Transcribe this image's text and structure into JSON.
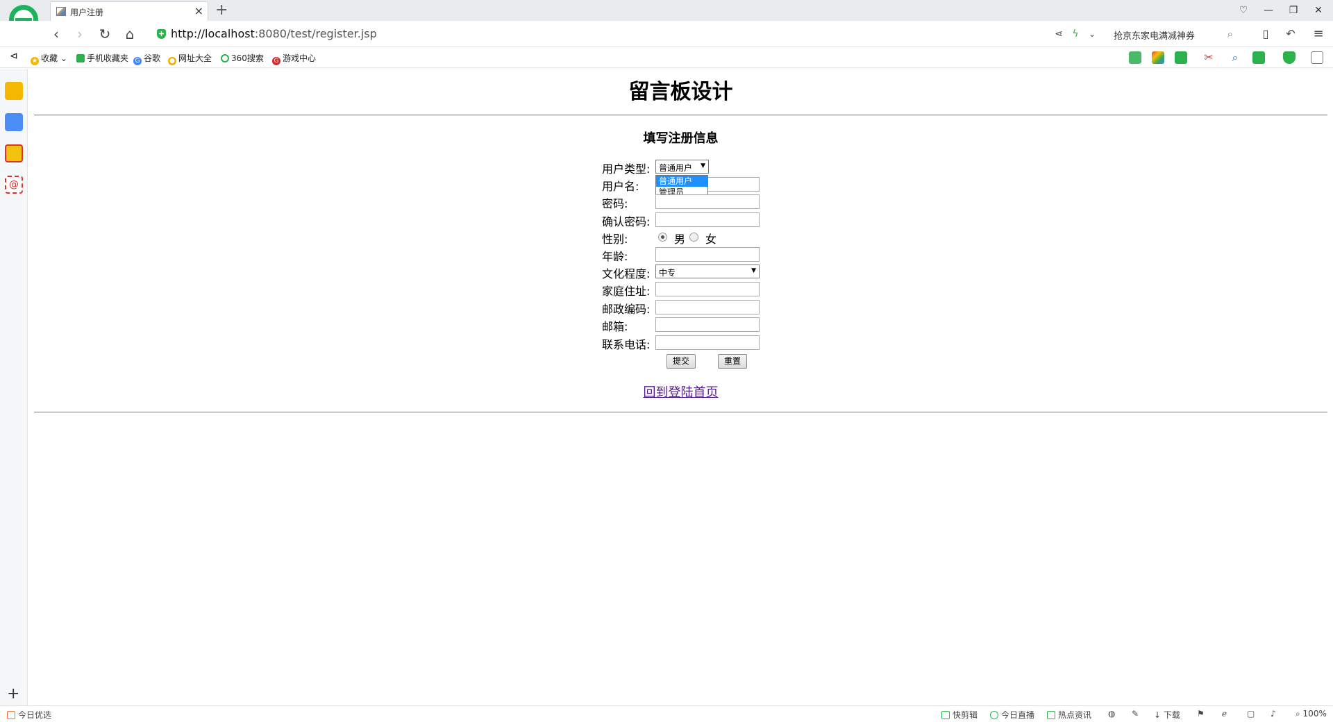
{
  "browser": {
    "tab_title": "用户注册",
    "new_tab": "+",
    "url_host": "http://localhost",
    "url_rest": ":8080/test/register.jsp",
    "search_text": "抢京东家电满减神券",
    "bookmarks": [
      "收藏",
      "手机收藏夹",
      "谷歌",
      "网址大全",
      "360搜索",
      "游戏中心"
    ],
    "status_left": "今日优选",
    "status_right": [
      "快剪辑",
      "今日直播",
      "热点资讯",
      "下载",
      "100%"
    ]
  },
  "page": {
    "title": "留言板设计",
    "subtitle": "填写注册信息",
    "labels": {
      "user_type": "用户类型:",
      "username": "用户名:",
      "password": "密码:",
      "confirm_password": "确认密码:",
      "gender": "性别:",
      "age": "年龄:",
      "education": "文化程度:",
      "address": "家庭住址:",
      "postcode": "邮政编码:",
      "email": "邮箱:",
      "phone": "联系电话:"
    },
    "user_type_selected": "普通用户",
    "user_type_options": [
      "普通用户",
      "管理员"
    ],
    "gender_options": [
      "男",
      "女"
    ],
    "education_selected": "中专",
    "submit_label": "提交",
    "reset_label": "重置",
    "back_link": "回到登陆首页"
  }
}
